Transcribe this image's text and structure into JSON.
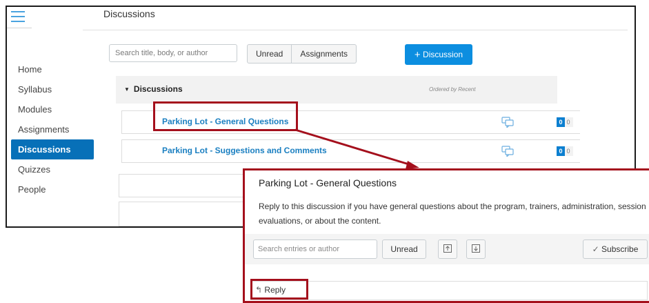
{
  "header": {
    "page_title": "Discussions"
  },
  "sidebar": {
    "items": [
      {
        "label": "Home",
        "active": false
      },
      {
        "label": "Syllabus",
        "active": false
      },
      {
        "label": "Modules",
        "active": false
      },
      {
        "label": "Assignments",
        "active": false
      },
      {
        "label": "Discussions",
        "active": true
      },
      {
        "label": "Quizzes",
        "active": false
      },
      {
        "label": "People",
        "active": false
      }
    ]
  },
  "toolbar": {
    "search_placeholder": "Search title, body, or author",
    "filter_unread": "Unread",
    "filter_assignments": "Assignments",
    "new_discussion_label": "Discussion"
  },
  "discussions": {
    "section_label": "Discussions",
    "ordered_by": "Ordered by Recent",
    "topics": [
      {
        "title": "Parking Lot - General Questions",
        "unread": "0",
        "total": "0"
      },
      {
        "title": "Parking Lot - Suggestions and Comments",
        "unread": "0",
        "total": "0"
      }
    ]
  },
  "zoom": {
    "title": "Parking Lot - General Questions",
    "body": "Reply to this discussion if you have general questions about the program, trainers, administration, session evaluations, or about the content.",
    "search_placeholder": "Search entries or author",
    "unread_label": "Unread",
    "subscribe_label": "Subscribe",
    "reply_label": "Reply"
  },
  "colors": {
    "accent": "#0770b8",
    "primary_button": "#0c8ee0",
    "link": "#1a7fc1",
    "callout": "#a40f1c"
  }
}
